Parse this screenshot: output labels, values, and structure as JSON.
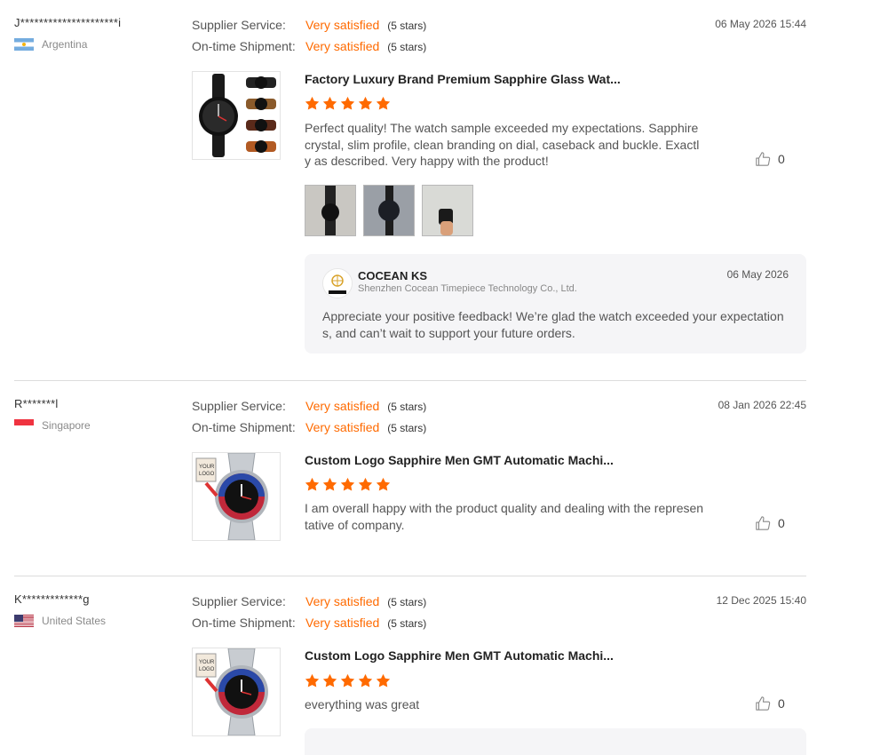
{
  "reviews": [
    {
      "username": "J*********************i",
      "country": "Argentina",
      "supplier_service_label": "Supplier Service:",
      "supplier_service_value": "Very satisfied",
      "supplier_service_stars": "(5 stars)",
      "shipment_label": "On-time Shipment:",
      "shipment_value": "Very satisfied",
      "shipment_stars": "(5 stars)",
      "date": "06 May 2026 15:44",
      "product_title": "Factory Luxury Brand Premium Sapphire Glass Wat...",
      "rating": 5,
      "comment": "Perfect quality! The watch sample exceeded my expectations. Sapphire crystal, slim profile, clean branding on dial, caseback and buckle. Exactly as described. Very happy with the product!",
      "likes": "0",
      "reply": {
        "name": "COCEAN KS",
        "company": "Shenzhen Cocean Timepiece Technology Co., Ltd.",
        "date": "06 May 2026",
        "text": "Appreciate your positive feedback! We’re glad the watch exceeded your expectations, and can’t wait to support your future orders."
      }
    },
    {
      "username": "R*******l",
      "country": "Singapore",
      "supplier_service_label": "Supplier Service:",
      "supplier_service_value": "Very satisfied",
      "supplier_service_stars": "(5 stars)",
      "shipment_label": "On-time Shipment:",
      "shipment_value": "Very satisfied",
      "shipment_stars": "(5 stars)",
      "date": "08 Jan 2026 22:45",
      "product_title": "Custom Logo Sapphire Men GMT Automatic Machi...",
      "rating": 5,
      "comment": "I am overall happy with the product quality and dealing with the representative of company.",
      "likes": "0"
    },
    {
      "username": "K*************g",
      "country": "United States",
      "supplier_service_label": "Supplier Service:",
      "supplier_service_value": "Very satisfied",
      "supplier_service_stars": "(5 stars)",
      "shipment_label": "On-time Shipment:",
      "shipment_value": "Very satisfied",
      "shipment_stars": "(5 stars)",
      "date": "12 Dec 2025 15:40",
      "product_title": "Custom Logo Sapphire Men GMT Automatic Machi...",
      "rating": 5,
      "comment": "everything was great",
      "likes": "0"
    }
  ],
  "colors": {
    "accent": "#ff6a00",
    "divider": "#dcdcdc",
    "reply_bg": "#f5f5f7"
  },
  "icons": {
    "star": "star-icon",
    "like": "thumbs-up-icon"
  }
}
